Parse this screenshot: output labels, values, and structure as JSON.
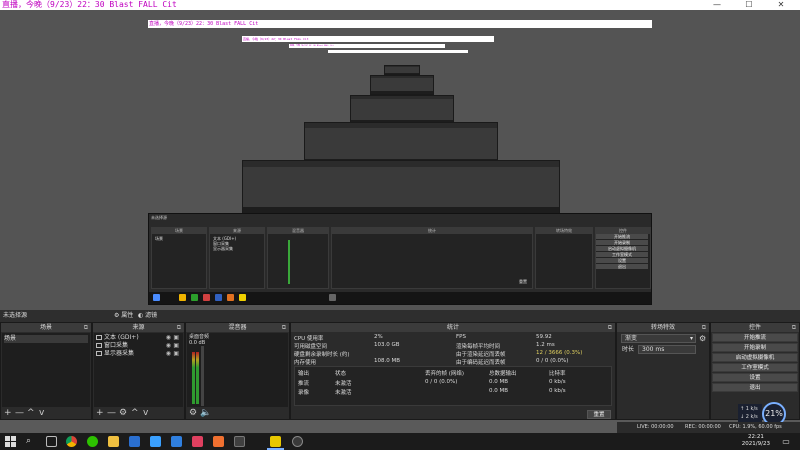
{
  "window": {
    "title": "直播，今晚（9/23）22：30 Blast FALL Cit",
    "min": "—",
    "max": "☐",
    "close": "✕"
  },
  "preview": {
    "nested_title": "直播，今晚（9/23）22：30 Blast FALL Cit",
    "nested_title_small": "直播，今晚（9/23）22：30 Blast FALL Cit",
    "nested_title_tiny": "直播，今晚（9/23）22：30 Blast FALL Cit"
  },
  "mini": {
    "caption": "未选择源",
    "panels": [
      "场景",
      "来源",
      "混音器",
      "统计",
      "转场特效",
      "控件"
    ],
    "scene_item": "场景",
    "sources": [
      "文本 (GDI+)",
      "窗口采集",
      "显示器采集"
    ],
    "buttons": [
      "开始推流",
      "开始录制",
      "启动虚拟摄像机",
      "工作室模式",
      "设置",
      "退出"
    ],
    "reset": "重置"
  },
  "scenebar": {
    "label": "未选择源",
    "properties": "属性",
    "filters": "滤镜"
  },
  "scenes": {
    "header": "场景",
    "items": [
      "场景"
    ],
    "footer": [
      "+",
      "—",
      "^",
      "v"
    ]
  },
  "sources": {
    "header": "来源",
    "items": [
      "文本 (GDI+)",
      "窗口采集",
      "显示器采集"
    ],
    "footer": [
      "+",
      "—",
      "⚙",
      "^",
      "v"
    ]
  },
  "mixer": {
    "header": "混音器",
    "channel": "桌面音频",
    "level": "0.0 dB"
  },
  "stats": {
    "header": "统计",
    "left_labels": [
      "CPU 使用率",
      "可用磁盘空间",
      "硬盘剩余录制时长 (约)",
      "内存使用"
    ],
    "left_values": [
      "2%",
      "103.0 GB",
      "",
      "108.0 MB"
    ],
    "right_labels": [
      "FPS",
      "渲染每帧平均时间",
      "由于渲染延迟而丢帧",
      "由于编码延迟而丢帧"
    ],
    "right_values": [
      "59.92",
      "1.2 ms",
      "12 / 3666 (0.3%)",
      "0 / 0 (0.0%)"
    ],
    "table_headers": [
      "输出",
      "状态",
      "丢弃的帧 (网络)",
      "总数据输出",
      "比特率"
    ],
    "rows": [
      [
        "推流",
        "未激活",
        "0 / 0 (0.0%)",
        "0.0 MB",
        "0 kb/s"
      ],
      [
        "录像",
        "未激活",
        "",
        "0.0 MB",
        "0 kb/s"
      ]
    ],
    "reset": "重置"
  },
  "transitions": {
    "header": "转场特效",
    "selected": "渐变",
    "duration_label": "时长",
    "duration": "300 ms"
  },
  "controls": {
    "header": "控件",
    "buttons": [
      "开始推流",
      "开始录制",
      "启动虚拟摄像机",
      "工作室模式",
      "设置",
      "退出"
    ]
  },
  "obs_status": {
    "live": "LIVE: 00:00:00",
    "rec": "REC: 00:00:00",
    "cpu": "CPU: 1.9%, 60.00 fps"
  },
  "net": {
    "up": "1 k/s",
    "down": "2 k/s",
    "gauge": "21%"
  },
  "taskbar": {
    "time": "22:21",
    "date": "2021/9/23",
    "icons": [
      "start-icon",
      "search-icon",
      "taskview-icon",
      "chrome-icon",
      "wechat-icon",
      "files-icon",
      "store-icon",
      "app-icon",
      "app2-icon",
      "music-icon",
      "app3-icon",
      "app4-icon",
      "obs-icon"
    ]
  },
  "colors": {
    "accent": "#c000c0",
    "meter": "#2f9a2f",
    "gauge": "#7ab0ff"
  }
}
